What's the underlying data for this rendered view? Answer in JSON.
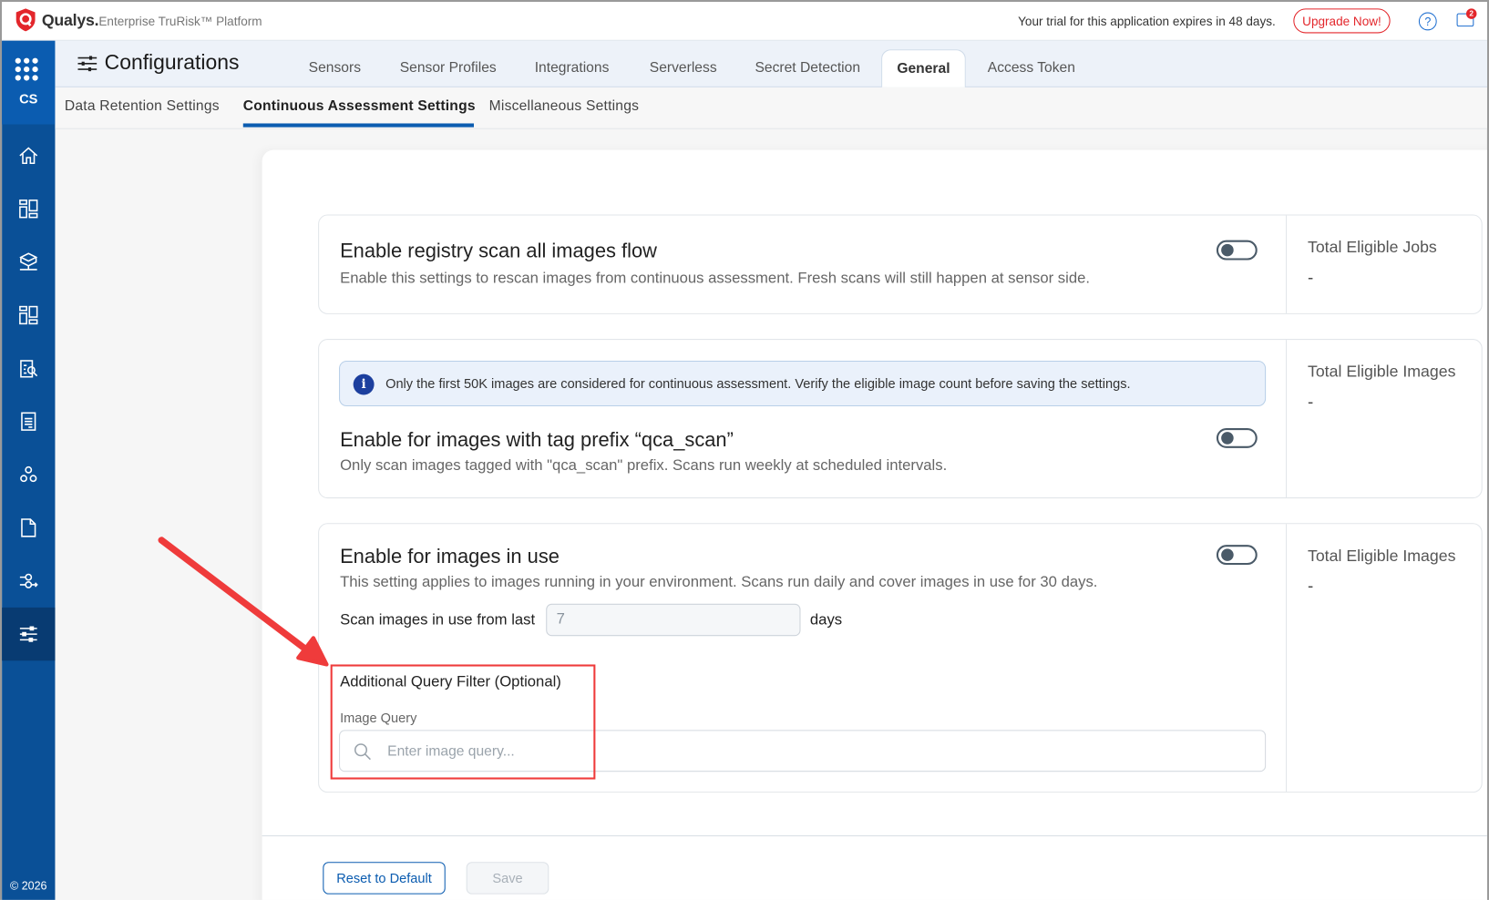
{
  "topbar": {
    "brand": "Qualys.",
    "platform": "Enterprise TruRisk™ Platform",
    "trial_text": "Your trial for this application expires in 48 days.",
    "upgrade_label": "Upgrade Now!",
    "help_symbol": "?",
    "notification_count": "2"
  },
  "sidebar": {
    "app_code": "CS",
    "items": [
      "home-icon",
      "dashboard-icon",
      "inventory-icon",
      "dashboard-alt-icon",
      "assessment-icon",
      "reports-icon",
      "components-icon",
      "document-icon",
      "policy-icon",
      "configurations-icon"
    ],
    "active_item": "configurations-icon",
    "copyright": "© 2026"
  },
  "header": {
    "title": "Configurations",
    "tabs": [
      "Sensors",
      "Sensor Profiles",
      "Integrations",
      "Serverless",
      "Secret Detection",
      "General",
      "Access Token"
    ],
    "active_tab": "General"
  },
  "subtabs": {
    "items": [
      "Data Retention Settings",
      "Continuous Assessment Settings",
      "Miscellaneous Settings"
    ],
    "active": "Continuous Assessment Settings"
  },
  "cards": [
    {
      "title": "Enable registry scan all images flow",
      "description": "Enable this settings to rescan images from continuous assessment. Fresh scans will still happen at sensor side.",
      "enabled": false,
      "side_label": "Total Eligible Jobs",
      "side_value": "-"
    },
    {
      "info": "Only the first 50K images are considered for continuous assessment. Verify the eligible image count before saving the settings.",
      "title": "Enable for images with tag prefix “qca_scan”",
      "description": "Only scan images tagged with \"qca_scan\" prefix. Scans run weekly at scheduled intervals.",
      "enabled": false,
      "side_label": "Total Eligible Images",
      "side_value": "-"
    },
    {
      "title": "Enable for images in use",
      "description": "This setting applies to images running in your environment. Scans run daily and cover images in use for 30 days.",
      "enabled": false,
      "side_label": "Total Eligible Images",
      "side_value": "-",
      "days_label": "Scan images in use from last",
      "days_value": "7",
      "days_unit": "days",
      "filter_heading": "Additional Query Filter (Optional)",
      "query_label": "Image Query",
      "query_placeholder": "Enter image query..."
    }
  ],
  "footer": {
    "reset_label": "Reset to Default",
    "save_label": "Save"
  },
  "colors": {
    "brand_blue": "#0b5cb0",
    "sidebar": "#0a5097",
    "accent_red": "#e3262b",
    "annotation": "#ef3b3b"
  }
}
